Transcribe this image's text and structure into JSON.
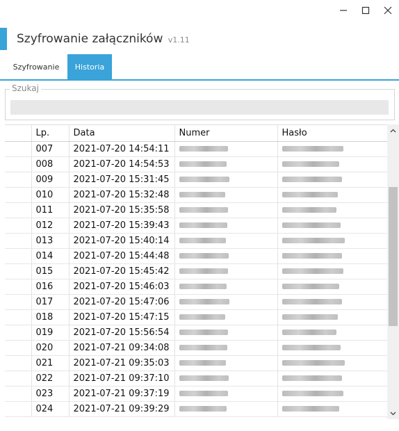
{
  "window": {
    "icons": [
      "minimize-icon",
      "maximize-icon",
      "close-icon"
    ]
  },
  "header": {
    "title": "Szyfrowanie załączników",
    "version": "v1.11",
    "accent_color": "#3aa3d9"
  },
  "tabs": [
    {
      "label": "Szyfrowanie",
      "active": false
    },
    {
      "label": "Historia",
      "active": true
    }
  ],
  "search": {
    "legend": "Szukaj",
    "value": ""
  },
  "table": {
    "columns": [
      "",
      "Lp.",
      "Data",
      "Numer",
      "Hasło"
    ],
    "rows": [
      {
        "lp": "007",
        "date": "2021-07-20 14:54:11"
      },
      {
        "lp": "008",
        "date": "2021-07-20 14:54:53"
      },
      {
        "lp": "009",
        "date": "2021-07-20 15:31:45"
      },
      {
        "lp": "010",
        "date": "2021-07-20 15:32:48"
      },
      {
        "lp": "011",
        "date": "2021-07-20 15:35:58"
      },
      {
        "lp": "012",
        "date": "2021-07-20 15:39:43"
      },
      {
        "lp": "013",
        "date": "2021-07-20 15:40:14"
      },
      {
        "lp": "014",
        "date": "2021-07-20 15:44:48"
      },
      {
        "lp": "015",
        "date": "2021-07-20 15:45:42"
      },
      {
        "lp": "016",
        "date": "2021-07-20 15:46:03"
      },
      {
        "lp": "017",
        "date": "2021-07-20 15:47:06"
      },
      {
        "lp": "018",
        "date": "2021-07-20 15:47:15"
      },
      {
        "lp": "019",
        "date": "2021-07-20 15:56:54"
      },
      {
        "lp": "020",
        "date": "2021-07-21 09:34:08"
      },
      {
        "lp": "021",
        "date": "2021-07-21 09:35:03"
      },
      {
        "lp": "022",
        "date": "2021-07-21 09:37:10"
      },
      {
        "lp": "023",
        "date": "2021-07-21 09:37:19"
      },
      {
        "lp": "024",
        "date": "2021-07-21 09:39:29"
      }
    ]
  }
}
